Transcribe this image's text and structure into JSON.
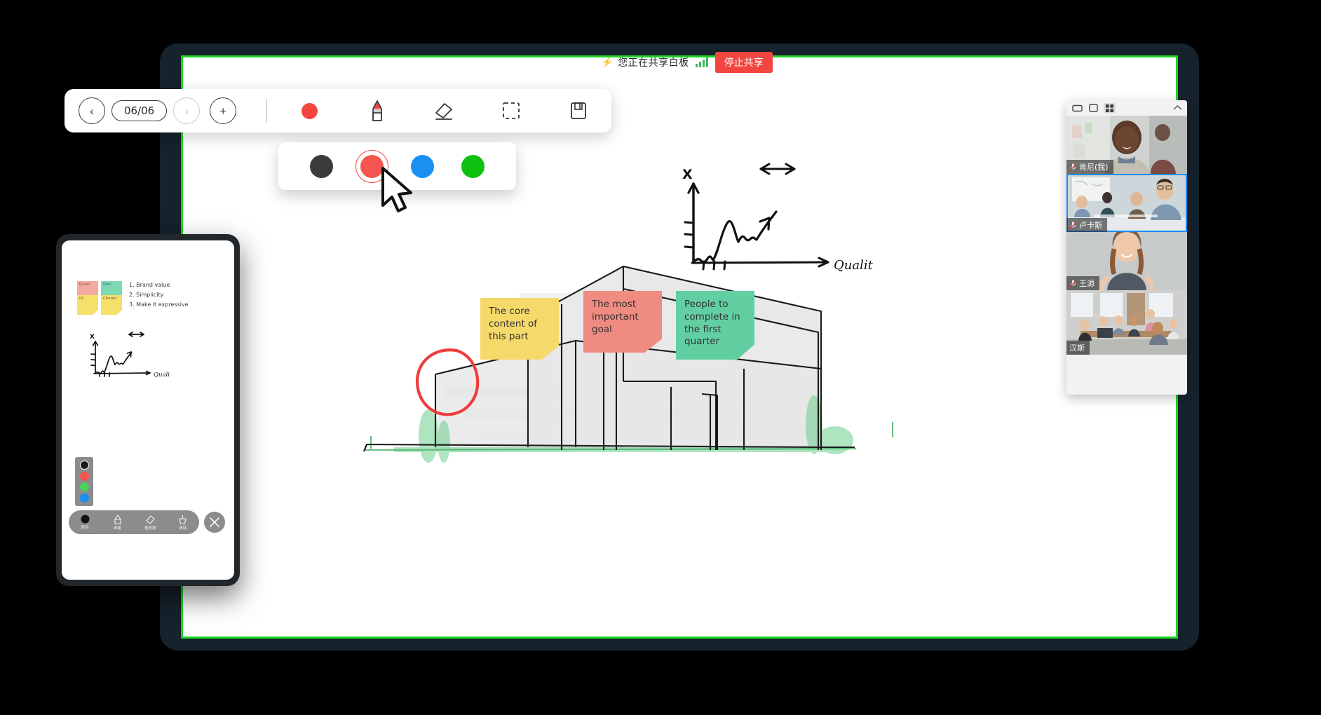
{
  "share_banner": {
    "bolt_icon": "bolt-icon",
    "text": "您正在共享白板",
    "signal_icon": "signal-bars-icon",
    "stop_label": "停止共享"
  },
  "toolbar": {
    "prev_label": "‹",
    "page_indicator": "06/06",
    "next_label": "›",
    "add_label": "+",
    "tools": [
      {
        "name": "color-dot",
        "label": "color"
      },
      {
        "name": "pencil-icon",
        "label": "pencil"
      },
      {
        "name": "eraser-icon",
        "label": "eraser"
      },
      {
        "name": "select-box-icon",
        "label": "select"
      },
      {
        "name": "save-icon",
        "label": "save"
      }
    ],
    "active_color": "#f4453f"
  },
  "palette": {
    "swatches": [
      {
        "name": "black",
        "color": "#3b3b3b",
        "selected": false
      },
      {
        "name": "red",
        "color": "#f4564f",
        "selected": true
      },
      {
        "name": "blue",
        "color": "#1a90f0",
        "selected": false
      },
      {
        "name": "green",
        "color": "#10c010",
        "selected": false
      }
    ]
  },
  "notes": [
    {
      "id": "yellow",
      "color": "#f5d96a",
      "text": "The core content of this part"
    },
    {
      "id": "red",
      "color": "#f08b82",
      "text": "The most important goal"
    },
    {
      "id": "green",
      "color": "#62cfa2",
      "text": "People to complete in the first quarter"
    }
  ],
  "sketch_chart": {
    "y_axis_label": "X",
    "x_axis_label": "Qualit"
  },
  "participants": {
    "layout_icons": [
      {
        "name": "layout-speaker-icon",
        "active": false
      },
      {
        "name": "layout-single-icon",
        "active": false
      },
      {
        "name": "layout-grid-icon",
        "active": true
      }
    ],
    "collapse_icon": "chevron-up-icon",
    "tiles": [
      {
        "name": "肯尼(我)",
        "muted": true,
        "active": false,
        "scene": "man-office"
      },
      {
        "name": "卢卡斯",
        "muted": true,
        "active": true,
        "scene": "team-table"
      },
      {
        "name": "王源",
        "muted": true,
        "active": false,
        "scene": "woman-portrait"
      },
      {
        "name": "汉斯",
        "muted": false,
        "active": false,
        "scene": "boardroom"
      }
    ]
  },
  "mobile_preview": {
    "sticky_notes": [
      {
        "label": "Gucci",
        "color": "#f4a9a0"
      },
      {
        "label": "Dior",
        "color": "#7fd9b5"
      },
      {
        "label": "LV",
        "color": "#f7e06a"
      },
      {
        "label": "Chanel",
        "color": "#f7e06a"
      }
    ],
    "list_items": [
      "1. Brand value",
      "2. Simplicity",
      "3. Make it expressive"
    ],
    "chart": {
      "y_axis_label": "X",
      "x_axis_label": "Quali"
    },
    "color_bar": [
      {
        "name": "black",
        "color": "#1a1a1a",
        "selected": true
      },
      {
        "name": "red",
        "color": "#f4564f",
        "selected": false
      },
      {
        "name": "green",
        "color": "#4dd15e",
        "selected": false
      },
      {
        "name": "blue",
        "color": "#1a90f0",
        "selected": false
      }
    ],
    "toolbar": [
      {
        "name": "color-tool",
        "label": "颜色",
        "icon": "filled-circle-icon"
      },
      {
        "name": "brush-tool",
        "label": "画笔",
        "icon": "pen-icon"
      },
      {
        "name": "eraser-tool",
        "label": "橡皮擦",
        "icon": "eraser-icon"
      },
      {
        "name": "clear-tool",
        "label": "清除",
        "icon": "broom-icon"
      }
    ],
    "close_icon": "close-icon"
  },
  "colors": {
    "screen_share_border": "#1fd325",
    "device_frame": "#16222c",
    "stop_share_bg": "#f3453f",
    "annotation_red": "#ee3d3d",
    "active_tile_outline": "#1a8cff"
  }
}
